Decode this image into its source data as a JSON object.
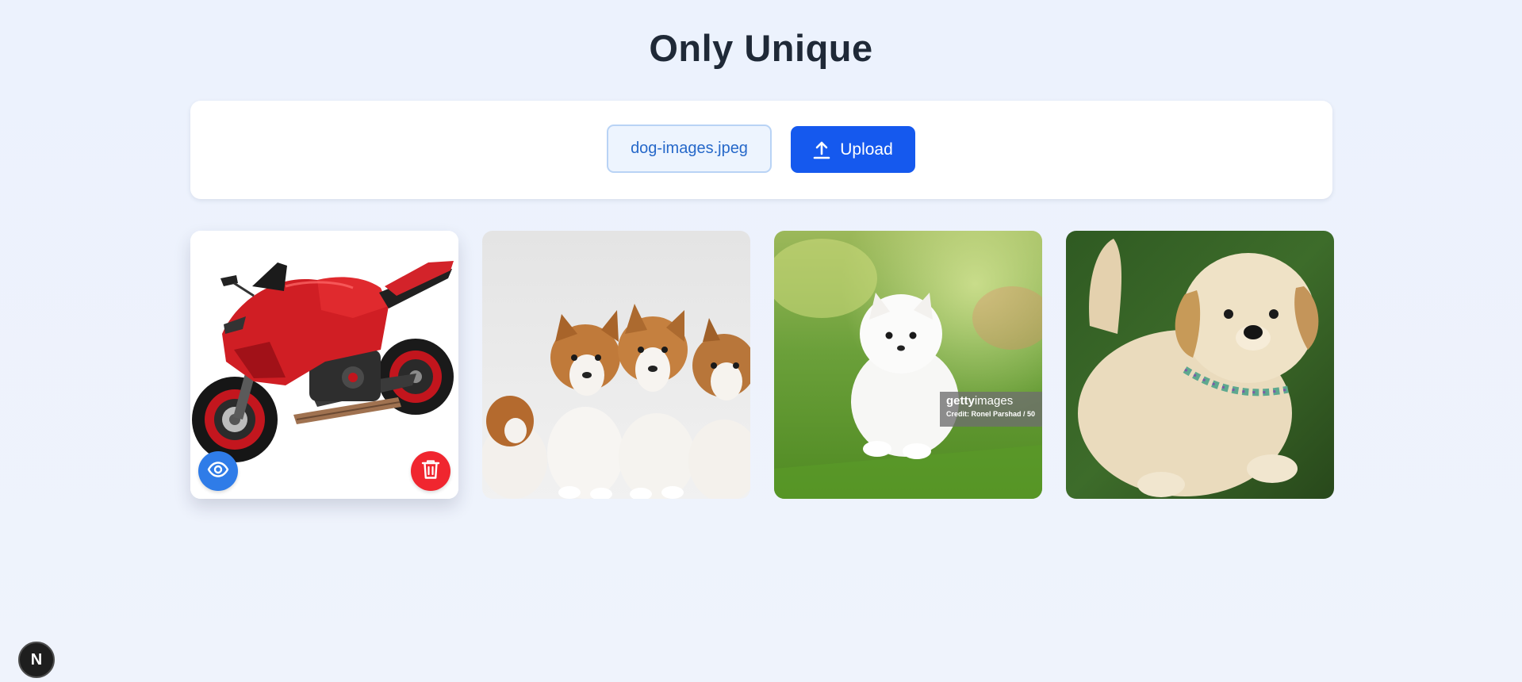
{
  "page": {
    "title": "Only Unique"
  },
  "upload": {
    "file_name": "dog-images.jpeg",
    "button_label": "Upload",
    "button_icon": "upload-arrow-icon"
  },
  "gallery": {
    "images": [
      {
        "subject": "red sport motorcycle",
        "actions": [
          "eye-icon",
          "trash-icon"
        ]
      },
      {
        "subject": "three corgi puppies"
      },
      {
        "subject": "white pomeranian puppy on grass",
        "watermark": {
          "brand_prefix": "getty",
          "brand_suffix": "images",
          "credit": "Credit: Ronel Parshad / 50"
        }
      },
      {
        "subject": "golden retriever puppy on grass"
      }
    ]
  },
  "dev_badge": {
    "label": "N"
  },
  "colors": {
    "accent": "#1559ee",
    "view": "#2f7ce8",
    "delete": "#f0262f"
  }
}
